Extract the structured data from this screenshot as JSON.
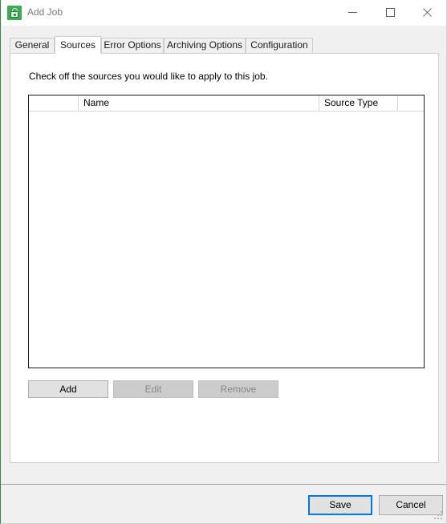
{
  "window": {
    "title": "Add Job",
    "icon": "padlock-app-icon",
    "controls": {
      "minimize": "minimize-icon",
      "maximize": "maximize-icon",
      "close": "close-icon"
    }
  },
  "tabs": [
    {
      "label": "General",
      "active": false
    },
    {
      "label": "Sources",
      "active": true
    },
    {
      "label": "Error Options",
      "active": false
    },
    {
      "label": "Archiving Options",
      "active": false
    },
    {
      "label": "Configuration",
      "active": false
    }
  ],
  "sources_tab": {
    "instruction": "Check off the sources you would like to apply to this job.",
    "list": {
      "columns": [
        {
          "label": "",
          "name": "checkbox-column"
        },
        {
          "label": "Name",
          "name": "name-column"
        },
        {
          "label": "Source Type",
          "name": "source-type-column"
        },
        {
          "label": "",
          "name": "filler-column"
        }
      ],
      "rows": []
    },
    "buttons": [
      {
        "label": "Add",
        "enabled": true
      },
      {
        "label": "Edit",
        "enabled": false
      },
      {
        "label": "Remove",
        "enabled": false
      }
    ]
  },
  "footer": {
    "save_label": "Save",
    "cancel_label": "Cancel"
  },
  "colors": {
    "accent_border": "#2e8b3d",
    "default_button_focus": "#0078d7",
    "window_background": "#f0f0f0",
    "panel_background": "#ffffff",
    "title_text": "#7a7a7a"
  }
}
